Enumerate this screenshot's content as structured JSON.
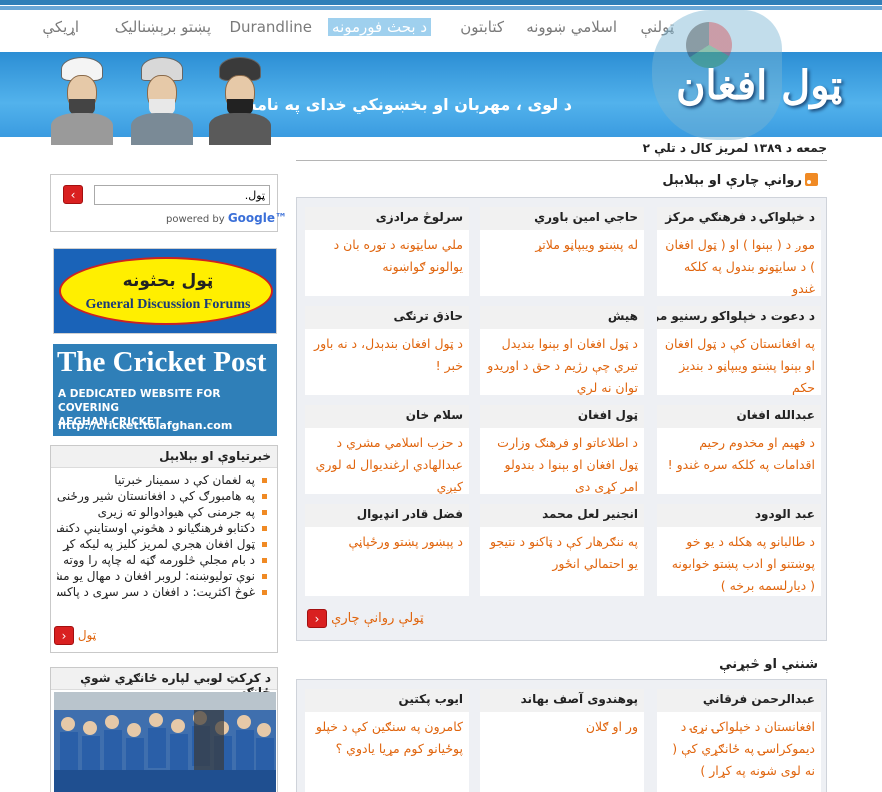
{
  "nav": {
    "items": [
      {
        "label": "ټولنې"
      },
      {
        "label": "اسلامي ښوونه"
      },
      {
        "label": "کتابتون"
      },
      {
        "label": "د بحث فورمونه"
      },
      {
        "label": "Durandline"
      },
      {
        "label": "پښتو برېښنالیک"
      },
      {
        "label": "اړیکې"
      }
    ]
  },
  "header": {
    "title": "ټول افغان",
    "tagline": "د لوی ، مهربان او بخښونکي خدای په نامه"
  },
  "date_text": "جمعه د ۱۳۸۹ لمریز کال د تلې ۲",
  "latest": {
    "title": "روانې چارې او بېلابېل",
    "cards": [
      {
        "author": "د خپلواکۍ د فرهنګي مرکز",
        "text": "موږ د ( بېنوا ) او ( ټول افغان ) د سایټونو بندول په کلکه غندو"
      },
      {
        "author": "حاجي امين باوري",
        "text": "له پښتو ويبپاڼو ملاتړ"
      },
      {
        "author": "سرلوڅ مرادزی",
        "text": "ملي سایټونه د توره بان د یوالونو ګواښونه"
      },
      {
        "author": "د دعوت د خپلواکو رسنيو مرکز",
        "text": "په افغانستان کې د ټول افغان او بېنوا پښتو ويبپاڼو د بنديز حکم"
      },
      {
        "author": "هيش",
        "text": "د ټول افغان او بېنوا بنديدل تيري چې رژيم د حق د اوريدو توان نه لري"
      },
      {
        "author": "حاذق ترنګی",
        "text": "د ټول افغان بندېدل، د نه باور خبر !"
      },
      {
        "author": "عبدالله افغان",
        "text": "د فهيم او مخدوم رحيم اقدامات په کلکه سره غندو !"
      },
      {
        "author": "ټول افغان",
        "text": "د اطلاعاتو او فرهنګ وزارت ټول افغان او بېنوا د بندولو امر کړی دی"
      },
      {
        "author": "سلام خان",
        "text": "د حزب اسلامي مشري د عبدالهادي ارغنديوال له لوري کيږي"
      },
      {
        "author": "عبد الودود",
        "text": "د طالبانو په هکله د يو خو پوښتنو او ادب پښتو خوابونه ( ديارلسمه برخه )"
      },
      {
        "author": "انجنير لعل محمد",
        "text": "په ننګرهار کې د ټاکنو د نتيجو يو احتمالي انځور"
      },
      {
        "author": "فضل قادر انډيوال",
        "text": "د پېښور پښتو ورځپاڼې"
      }
    ],
    "more_label": "ټولې روانې چارې"
  },
  "literature": {
    "title": "شننې او څېړنې",
    "cards": [
      {
        "author": "عبدالرحمن فرقاني",
        "text": "افغانستان د خپلواکۍ نړۍ د ديموکراسۍ په ځانګړي کې ( نه لوی شونه په کړار )"
      },
      {
        "author": "پوهندوی آصف بهاند",
        "text": "ور او ګلان"
      },
      {
        "author": "ايوب پکتين",
        "text": "کامرون په سنګين کې د خپلو پوځيانو کوم مړيا يادوي ؟"
      }
    ]
  },
  "search": {
    "placeholder": "ټول.",
    "powered_text": "powered by",
    "google_label": "Google™"
  },
  "forum_banner": {
    "pashto": "ټول بحثونه",
    "english": "General Discussion Forums"
  },
  "cricket_banner": {
    "title": "The Cricket Post",
    "subtitle_line1": "A DEDICATED WEBSITE FOR COVERING",
    "subtitle_line2": "AFGHAN CRICKET",
    "url": "http://cricket.tolafghan.com"
  },
  "news_panel": {
    "title": "خبرتياوې او بېلابېل",
    "items": [
      "په لغمان کې د سمینار خبرتیا",
      "په هامبورګ کې د افغانستان شير ورځنی",
      "په جرمنی کې هیوادوالو ته زیری",
      "دکتابو فرهنګیانو د هڅونې اوستاینې دکنفرانس",
      "ټول افغان هجري لمریز کلیز په لیکه کړ",
      "د بام مجلې څلورمه ګڼه له چاپه را ووته",
      "نوې تولیوښنه: لروبر افغان د مهال يو مشر نه",
      "غوڅ اکثریت: د افغان د سر سړی د پاکستان د"
    ],
    "more_label": "ټول"
  },
  "cricket_panel": {
    "title": "د کرکټ لوبي لپاره ځانګړي شوې ځانګه"
  },
  "colors": {
    "accent_orange": "#e0650e",
    "nav_active": "#9fd0ee",
    "banner_blue": "#3a9be0",
    "button_red": "#d92020"
  }
}
